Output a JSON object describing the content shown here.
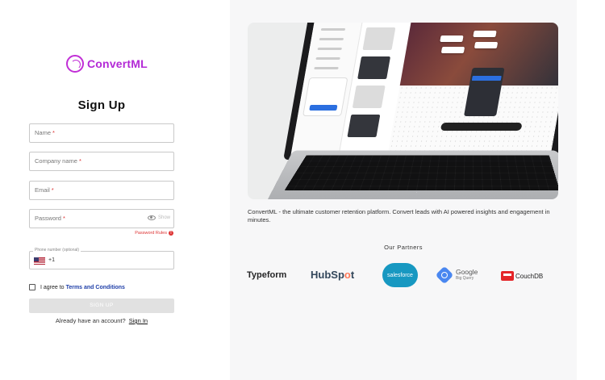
{
  "brand": {
    "name": "ConvertML"
  },
  "form": {
    "title": "Sign Up",
    "fields": [
      {
        "label": "Name",
        "required_mark": "*"
      },
      {
        "label": "Company name",
        "required_mark": "*"
      },
      {
        "label": "Email",
        "required_mark": "*"
      },
      {
        "label": "Password",
        "required_mark": "*",
        "toggle_label": "Show"
      }
    ],
    "password_rules": "Password Rules",
    "phone": {
      "label": "Phone number (optional)",
      "dial_code": "+1"
    },
    "agree_text": "I agree to",
    "terms_link": "Terms and Conditions",
    "submit_label": "SIGN UP",
    "signin_prompt": "Already have an account?",
    "signin_link": "Sign In"
  },
  "promo": {
    "description": "ConvertML - the ultimate customer retention platform. Convert leads with AI powered insights and engagement in minutes.",
    "partners_title": "Our Partners",
    "partners": {
      "typeform": "Typeform",
      "hubspot_a": "HubSp",
      "hubspot_o": "o",
      "hubspot_b": "t",
      "salesforce": "salesforce",
      "google": "Google",
      "bigquery": "Big Query",
      "couchdb": "CouchDB"
    }
  },
  "colors": {
    "brand": "#b32ad6",
    "link": "#1f3fa8",
    "error": "#dd3333",
    "button_disabled": "#e1e1e1"
  }
}
